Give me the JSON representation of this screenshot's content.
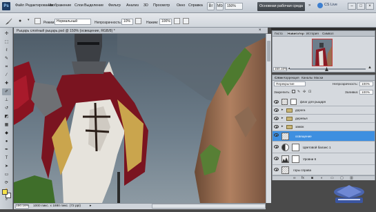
{
  "menubar": {
    "logo": "Ps",
    "items": [
      "Файл",
      "Редактирование",
      "Изображение",
      "Слои",
      "Выделение",
      "Фильтр",
      "Анализ",
      "3D",
      "Просмотр",
      "Окно",
      "Справка"
    ],
    "zoom": "150%",
    "workspace": "Основная рабочая среда",
    "cs_live": "CS Live"
  },
  "options": {
    "mode_label": "Режим:",
    "mode_value": "Нормальный",
    "opacity_label": "Непрозрачность:",
    "opacity_value": "10%",
    "flow_label": "Нажим:",
    "flow_value": "100%"
  },
  "document": {
    "title": "Рыцарь слоёный рыцарь.psd @ 150% (освещение, RGB/8) *",
    "status_zoom": "150.16%",
    "status_info": "1000 пикс. x 1880 пикс. (72 ppi)"
  },
  "navigator": {
    "tabs": [
      "Гисто",
      "Навигатор",
      "История",
      "Символ"
    ],
    "zoom": "150.16%"
  },
  "layers": {
    "tabs": [
      "Слои",
      "Коррекция",
      "Каналы",
      "Маски"
    ],
    "blend_mode": "Перекрытие",
    "opacity_label": "Непрозрачность:",
    "opacity_value": "100%",
    "lock_label": "Закрепить:",
    "fill_label": "Заливка:",
    "fill_value": "100%",
    "rows": [
      {
        "name": "флаг для рыцаря",
        "type": "layer",
        "selected": false
      },
      {
        "name": "дорога",
        "type": "group",
        "selected": false
      },
      {
        "name": "деревья",
        "type": "group",
        "selected": false
      },
      {
        "name": "замок",
        "type": "group",
        "selected": false
      },
      {
        "name": "освещение",
        "type": "layer",
        "selected": true
      },
      {
        "name": "Цветовой баланс 1",
        "type": "adjustment",
        "selected": false
      },
      {
        "name": "Уровни 6",
        "type": "adjustment",
        "selected": false
      },
      {
        "name": "горы справа",
        "type": "layer",
        "selected": false
      }
    ],
    "bottom_icons": [
      "link-icon",
      "fx-icon",
      "mask-icon",
      "adjust-icon",
      "folder-icon",
      "new-layer-icon",
      "trash-icon"
    ]
  },
  "colors": {
    "selection_blue": "#3e8fe0",
    "foreground": "#f7e34b",
    "background": "#ffffff"
  }
}
